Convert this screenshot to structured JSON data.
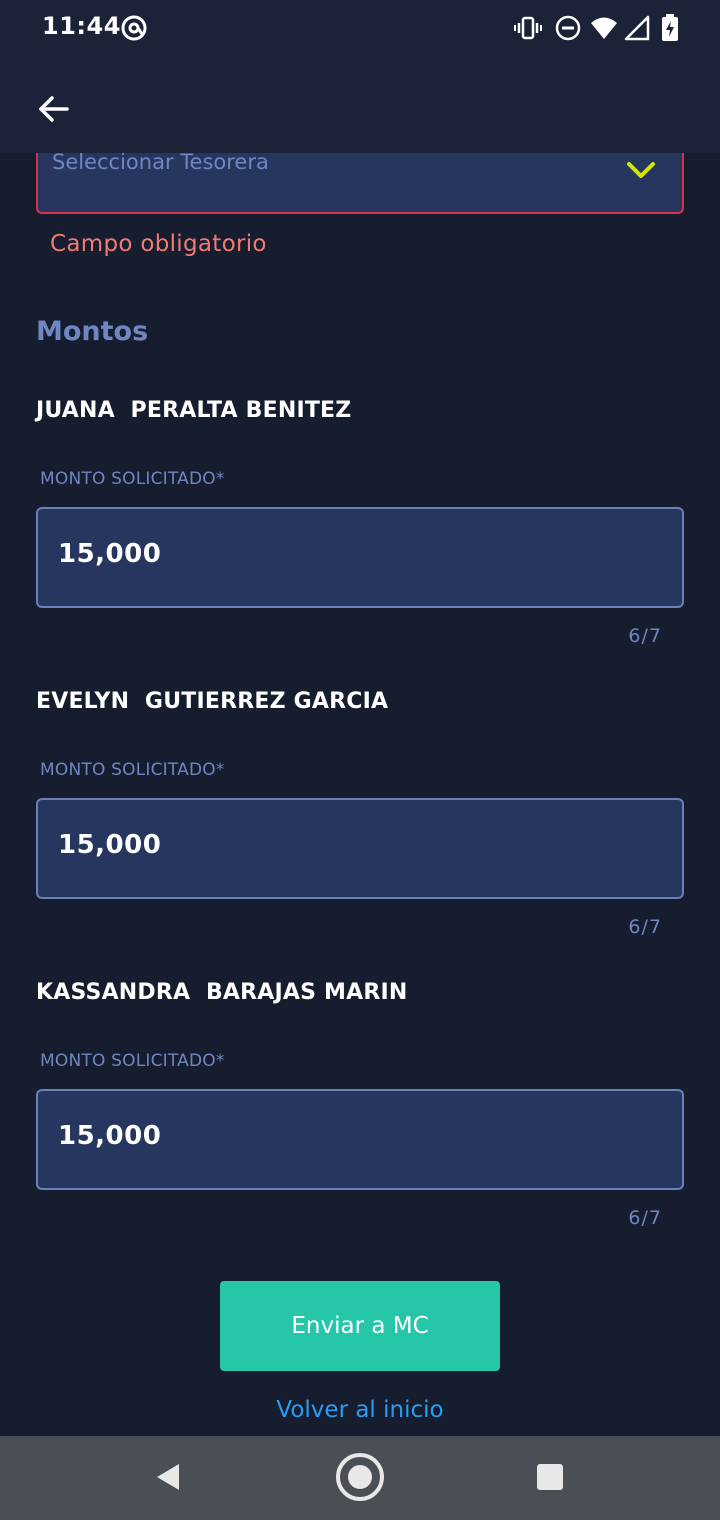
{
  "status_bar": {
    "time": "11:44",
    "icons": [
      "at-sign-icon",
      "vibrate-icon",
      "do-not-disturb-icon",
      "wifi-icon",
      "signal-icon",
      "battery-charging-icon"
    ]
  },
  "app_bar": {
    "back_icon": "arrow-left-icon"
  },
  "treasurer_select": {
    "placeholder": "Seleccionar Tesorera",
    "error": "Campo obligatorio"
  },
  "section": {
    "title": "Montos"
  },
  "members": [
    {
      "name": "JUANA  PERALTA BENITEZ",
      "label": "MONTO SOLICITADO*",
      "value": "15,000",
      "counter": "6/7"
    },
    {
      "name": "EVELYN  GUTIERREZ GARCIA",
      "label": "MONTO SOLICITADO*",
      "value": "15,000",
      "counter": "6/7"
    },
    {
      "name": "KASSANDRA  BARAJAS MARIN",
      "label": "MONTO SOLICITADO*",
      "value": "15,000",
      "counter": "6/7"
    }
  ],
  "actions": {
    "submit_label": "Enviar a MC",
    "home_link": "Volver al inicio"
  },
  "nav_bar": {
    "icons": [
      "nav-back-icon",
      "nav-home-icon",
      "nav-recents-icon"
    ]
  },
  "colors": {
    "background": "#161d2f",
    "field": "#27365e",
    "accent": "#26c6a9",
    "error": "#f27a72",
    "link": "#2a9df2"
  }
}
